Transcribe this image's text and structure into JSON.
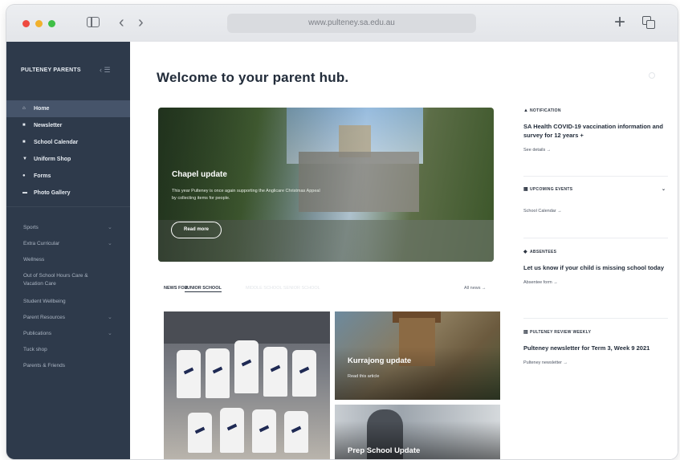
{
  "browser": {
    "url": "www.pulteney.sa.edu.au",
    "back_glyph": "‹",
    "forward_glyph": "›",
    "new_tab_glyph": "+"
  },
  "sidebar": {
    "brand": "PULTENEY PARENTS",
    "collapse_glyph": "‹ ☰",
    "primary_items": [
      {
        "label": "Home",
        "icon": "house-icon",
        "glyph": "⌂",
        "active": true
      },
      {
        "label": "Newsletter",
        "icon": "newspaper-icon",
        "glyph": "■"
      },
      {
        "label": "School Calendar",
        "icon": "calendar-icon",
        "glyph": "■"
      },
      {
        "label": "Uniform Shop",
        "icon": "tshirt-icon",
        "glyph": "▼"
      },
      {
        "label": "Forms",
        "icon": "form-icon",
        "glyph": "●"
      },
      {
        "label": "Photo Gallery",
        "icon": "photo-icon",
        "glyph": "▬"
      }
    ],
    "secondary_items": [
      {
        "label": "Sports",
        "has_submenu": true
      },
      {
        "label": "Extra Curricular",
        "has_submenu": true
      },
      {
        "label": "Wellness",
        "has_submenu": false
      },
      {
        "label": "Out of School Hours Care & Vacation Care",
        "has_submenu": false
      },
      {
        "label": "Student Wellbeing",
        "has_submenu": false
      },
      {
        "label": "Parent Resources",
        "has_submenu": true
      },
      {
        "label": "Publications",
        "has_submenu": true
      },
      {
        "label": "Tuck shop",
        "has_submenu": false
      },
      {
        "label": "Parents & Friends",
        "has_submenu": false
      }
    ],
    "chevron_glyph": "⌄"
  },
  "main": {
    "title": "Welcome to your parent hub.",
    "hero": {
      "title": "Chapel update",
      "text": "This year Pulteney is once again supporting the Anglicare Christmas Appeal by collecting items for people.",
      "button": "Read more"
    },
    "news": {
      "label": "NEWS FOR",
      "active_tab": "JUNIOR SCHOOL",
      "faded_tabs": "MIDDLE SCHOOL    SENIOR SCHOOL",
      "all_news": "All news →"
    },
    "cards": [
      {
        "title": "Kurrajong update",
        "sub": "Read this article"
      },
      {
        "title": "Prep School Update"
      }
    ]
  },
  "right": {
    "notification": {
      "heading": "NOTIFICATION",
      "body": "SA Health COVID-19 vaccination information and survey for 12 years +",
      "link": "See details  →"
    },
    "events": {
      "heading": "UPCOMING EVENTS",
      "link": "School Calendar  →"
    },
    "absentees": {
      "heading": "ABSENTEES",
      "body": "Let us know if your child is missing school today",
      "link": "Absentee form  →"
    },
    "review": {
      "heading": "PULTENEY REVIEW WEEKLY",
      "body": "Pulteney newsletter for Term 3, Week 9 2021",
      "link": "Pulteney newsletter  →"
    },
    "bell_glyph": "▲",
    "calendar_glyph": "▦",
    "user_glyph": "◆",
    "book_glyph": "▤",
    "chev_glyph": "⌄"
  }
}
